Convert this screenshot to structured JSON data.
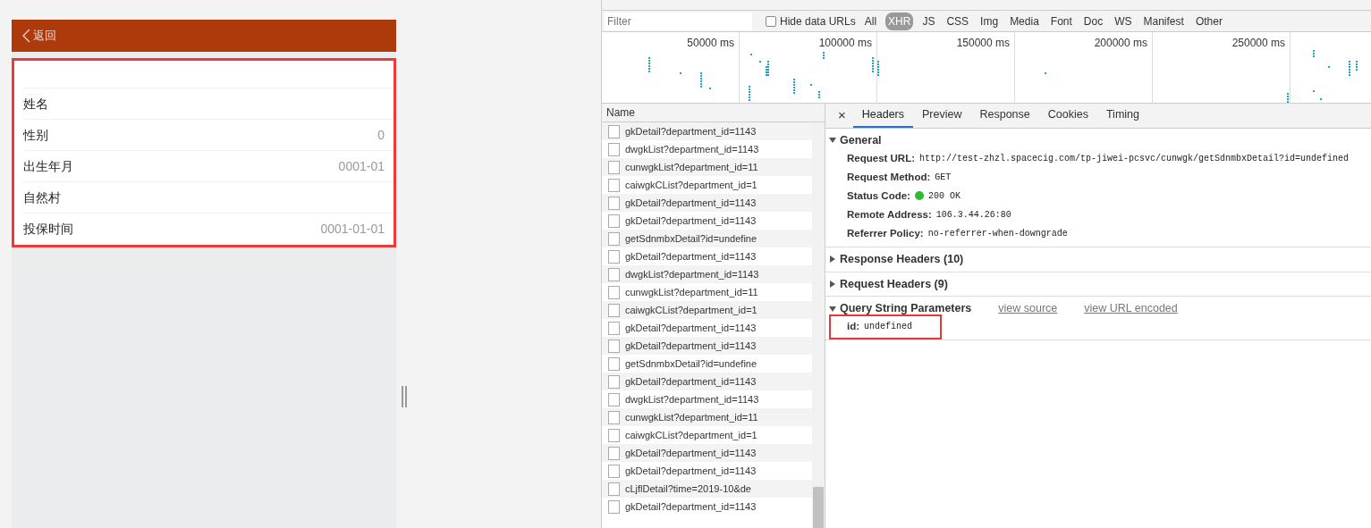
{
  "app": {
    "back_label": "返回",
    "rows": [
      {
        "label": "",
        "value": ""
      },
      {
        "label": "姓名",
        "value": ""
      },
      {
        "label": "性别",
        "value": "0"
      },
      {
        "label": "出生年月",
        "value": "0001-01"
      },
      {
        "label": "自然村",
        "value": ""
      },
      {
        "label": "投保时间",
        "value": "0001-01-01"
      }
    ]
  },
  "devtools": {
    "filter": {
      "placeholder": "Filter"
    },
    "hide_data_urls": {
      "label": "Hide data URLs",
      "checked": false
    },
    "types": [
      {
        "label": "All",
        "selected": false
      },
      {
        "label": "XHR",
        "selected": true
      },
      {
        "label": "JS",
        "selected": false
      },
      {
        "label": "CSS",
        "selected": false
      },
      {
        "label": "Img",
        "selected": false
      },
      {
        "label": "Media",
        "selected": false
      },
      {
        "label": "Font",
        "selected": false
      },
      {
        "label": "Doc",
        "selected": false
      },
      {
        "label": "WS",
        "selected": false
      },
      {
        "label": "Manifest",
        "selected": false
      },
      {
        "label": "Other",
        "selected": false
      }
    ],
    "timeline_ticks": [
      "50000 ms",
      "100000 ms",
      "150000 ms",
      "200000 ms",
      "250000 ms"
    ],
    "name_header": "Name",
    "requests": [
      "gkDetail?department_id=1143",
      "dwgkList?department_id=1143",
      "cunwgkList?department_id=11",
      "caiwgkCList?department_id=1",
      "gkDetail?department_id=1143",
      "gkDetail?department_id=1143",
      "getSdnmbxDetail?id=undefine",
      "gkDetail?department_id=1143",
      "dwgkList?department_id=1143",
      "cunwgkList?department_id=11",
      "caiwgkCList?department_id=1",
      "gkDetail?department_id=1143",
      "gkDetail?department_id=1143",
      "getSdnmbxDetail?id=undefine",
      "gkDetail?department_id=1143",
      "dwgkList?department_id=1143",
      "cunwgkList?department_id=11",
      "caiwgkCList?department_id=1",
      "gkDetail?department_id=1143",
      "gkDetail?department_id=1143",
      "cLjflDetail?time=2019-10&de",
      "gkDetail?department_id=1143"
    ],
    "close": "×",
    "tabs": [
      {
        "label": "Headers",
        "selected": true
      },
      {
        "label": "Preview",
        "selected": false
      },
      {
        "label": "Response",
        "selected": false
      },
      {
        "label": "Cookies",
        "selected": false
      },
      {
        "label": "Timing",
        "selected": false
      }
    ],
    "sections": [
      {
        "title": "General",
        "expanded": true,
        "fields": [
          {
            "key": "Request URL:",
            "value": "http://test-zhzl.spacecig.com/tp-jiwei-pcsvc/cunwgk/getSdnmbxDetail?id=undefined",
            "kind": "text"
          },
          {
            "key": "Request Method:",
            "value": "GET",
            "kind": "text"
          },
          {
            "key": "Status Code:",
            "value": "200 OK",
            "kind": "status"
          },
          {
            "key": "Remote Address:",
            "value": "106.3.44.26:80",
            "kind": "text"
          },
          {
            "key": "Referrer Policy:",
            "value": "no-referrer-when-downgrade",
            "kind": "text"
          }
        ]
      },
      {
        "title": "Response Headers (10)",
        "expanded": false
      },
      {
        "title": "Request Headers (9)",
        "expanded": false
      },
      {
        "title": "Query String Parameters",
        "expanded": true,
        "links": [
          "view source",
          "view URL encoded"
        ],
        "fields": [
          {
            "key": "id:",
            "value": "undefined",
            "kind": "highlighted"
          }
        ]
      }
    ]
  }
}
